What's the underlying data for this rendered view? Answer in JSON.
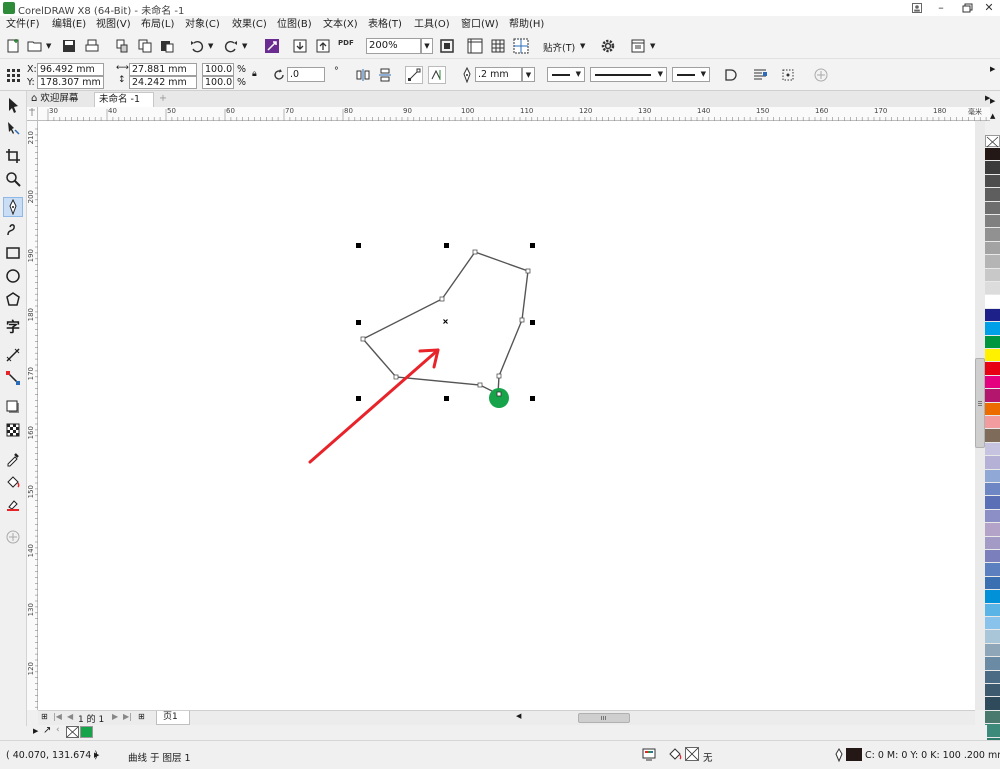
{
  "window": {
    "title": "CorelDRAW X8 (64-Bit) - 未命名 -1",
    "controls": [
      "user-icon",
      "minimize",
      "restore",
      "close"
    ]
  },
  "menu": [
    {
      "label": "文件(F)"
    },
    {
      "label": "编辑(E)"
    },
    {
      "label": "视图(V)"
    },
    {
      "label": "布局(L)"
    },
    {
      "label": "对象(C)"
    },
    {
      "label": "效果(C)"
    },
    {
      "label": "位图(B)"
    },
    {
      "label": "文本(X)"
    },
    {
      "label": "表格(T)"
    },
    {
      "label": "工具(O)"
    },
    {
      "label": "窗口(W)"
    },
    {
      "label": "帮助(H)"
    }
  ],
  "standard_toolbar": {
    "zoom": "200%",
    "snap_label": "贴齐(T)",
    "pdf_label": "PDF"
  },
  "property_bar": {
    "x_label": "X:",
    "x_value": "96.492 mm",
    "y_label": "Y:",
    "y_value": "178.307 mm",
    "width": "27.881 mm",
    "height": "24.242 mm",
    "scale_x": "100.0",
    "scale_y": "100.0",
    "percent": "%",
    "rotation": ".0",
    "degree": "°",
    "outline_width": ".2 mm"
  },
  "tabs": {
    "welcome": "欢迎屏幕",
    "document": "未命名 -1",
    "add": "+"
  },
  "ruler": {
    "h_ticks": [
      "30",
      "40",
      "50",
      "60",
      "70",
      "80",
      "90",
      "100",
      "110",
      "120",
      "130",
      "140",
      "150",
      "160",
      "170",
      "180"
    ],
    "h_unit": "毫米",
    "v_ticks": [
      "210",
      "200",
      "190",
      "180",
      "170",
      "160",
      "150",
      "140",
      "130",
      "120"
    ]
  },
  "page_nav": {
    "page_of": "1 的 1",
    "page_tab": "页1"
  },
  "status": {
    "coordinates": "( 40.070, 131.674 )",
    "object_info": "曲线 于 图层 1",
    "fill_none": "无",
    "outline_info": "C: 0 M: 0 Y: 0 K: 100 .200 mm"
  },
  "colors": {
    "selected_node": "#16a34a",
    "arrow": "#e8232a",
    "curve": "#555555",
    "handle": "#000000",
    "tab_active": "#ffffff",
    "outline_swatch": "#231815"
  },
  "palette": [
    "#231815",
    "#3c3c3c",
    "#4d4d4d",
    "#5e5e5e",
    "#6e6e6e",
    "#808080",
    "#919191",
    "#a3a3a3",
    "#b5b5b5",
    "#c8c8c8",
    "#dcdcdc",
    "#ffffff",
    "#1d2088",
    "#00a0e9",
    "#00963f",
    "#fff100",
    "#e60012",
    "#e4007f",
    "#b3176d",
    "#ed6c00",
    "#f29c9f",
    "#7e6b5a",
    "#c6c3e1",
    "#b5b0d6",
    "#8fa8d5",
    "#6f86c4",
    "#5a6fb5",
    "#8b8fc6",
    "#b4a3c9",
    "#a39bc6",
    "#7b7fbc",
    "#5b7fbf",
    "#3a6fb2",
    "#0091d9",
    "#5ab4e5",
    "#89c3eb",
    "#a9c6d9",
    "#8fa6b8",
    "#6b8aa3",
    "#4b6b85",
    "#3d5a6e",
    "#2f4a5a",
    "#4a7a6e",
    "#3e8a7a",
    "#2f7a6a",
    "#5a9a8a",
    "#7aa99a",
    "#9ab8aa"
  ]
}
